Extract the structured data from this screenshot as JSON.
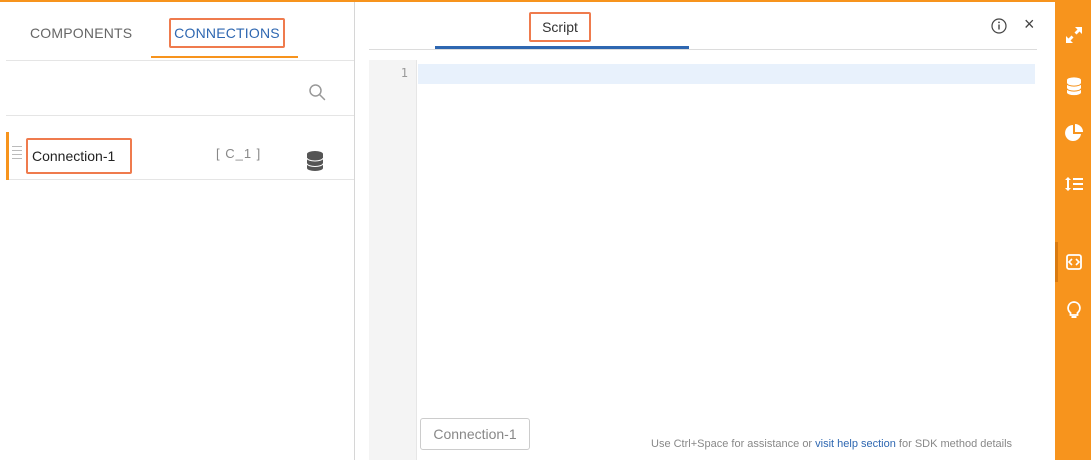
{
  "colors": {
    "accent": "#f7941d",
    "highlight": "#ef7b4d",
    "link": "#2e67b1"
  },
  "left_panel": {
    "tabs": [
      {
        "label": "COMPONENTS",
        "active": false
      },
      {
        "label": "CONNECTIONS",
        "active": true
      }
    ],
    "search": {
      "icon": "search-icon"
    },
    "connections": [
      {
        "name": "Connection-1",
        "alias": "[ C_1 ]",
        "icon": "database-icon"
      }
    ]
  },
  "editor_panel": {
    "tab_label": "Script",
    "info_icon": "info-icon",
    "close_glyph": "×",
    "line_numbers": [
      "1"
    ],
    "connection_chip": "Connection-1",
    "hint": {
      "prefix": "Use Ctrl+Space for assistance or ",
      "link": "visit help section",
      "suffix": " for SDK method details"
    }
  },
  "right_sidebar": {
    "items": [
      "expand-icon",
      "database-icon",
      "pie-chart-icon",
      "sort-list-icon",
      "script-icon",
      "lightbulb-icon"
    ],
    "active": "script-icon"
  }
}
